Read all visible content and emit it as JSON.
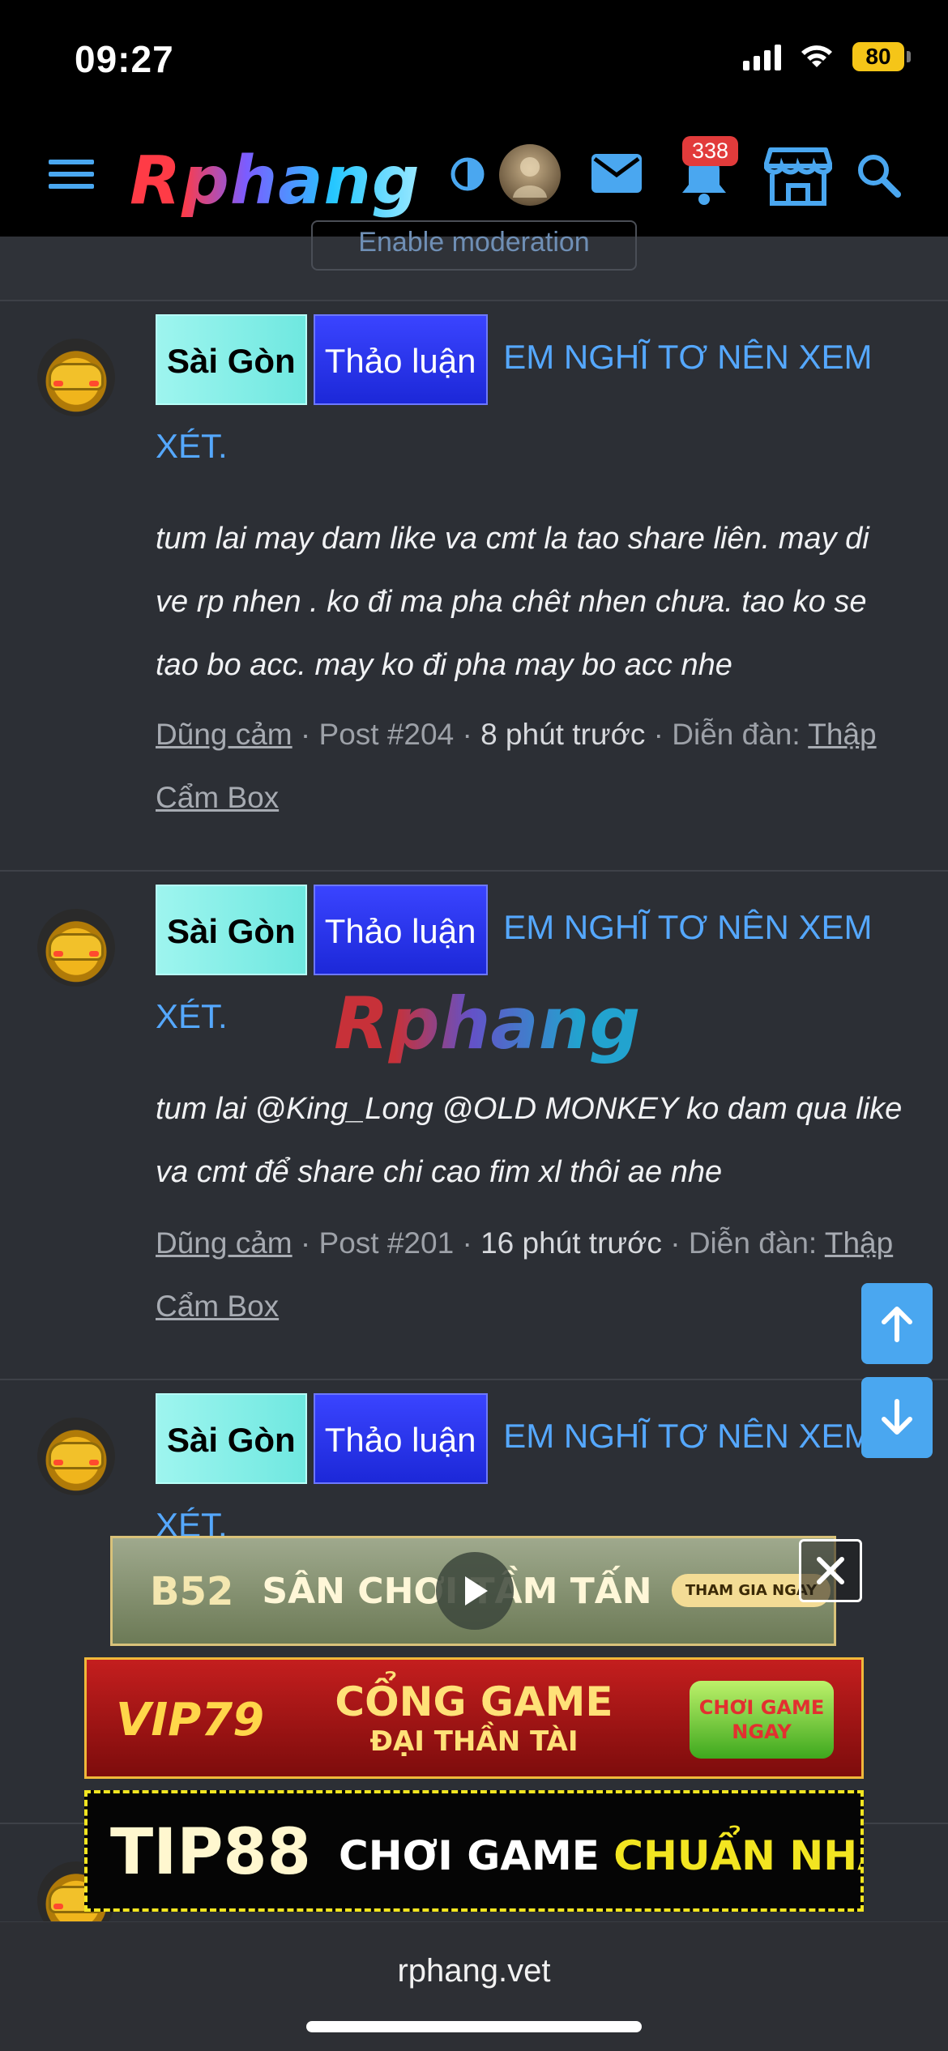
{
  "status_bar": {
    "time": "09:27",
    "battery": "80"
  },
  "nav": {
    "logo": "Rphang",
    "notification_count": "338"
  },
  "prev_block": {
    "button_label": "Enable moderation"
  },
  "posts": [
    {
      "tag1": "Sài Gòn",
      "tag2": "Thảo luận",
      "title_a": "EM NGHĨ TƠ NÊN XEM",
      "title_b": "XÉT.",
      "body_1": "tum lai may dam like va cmt la tao share liên. may di",
      "body_2": "ve rp nhen . ko đi ma pha chêt nhen chưa. tao ko se",
      "body_3": "tao bo acc. may ko đi pha may bo acc nhe",
      "author": "Dũng cảm",
      "post_no": "Post #204",
      "time": "8 phút trước",
      "forum_label": "Diễn đàn:",
      "forum": "Thập Cẩm Box"
    },
    {
      "tag1": "Sài Gòn",
      "tag2": "Thảo luận",
      "title_a": "EM NGHĨ TƠ NÊN XEM",
      "title_b": "XÉT.",
      "body_1": "tum lai @King_Long @OLD MONKEY ko dam qua like",
      "body_2": "va cmt để share chi cao fim xl thôi ae nhe",
      "author": "Dũng cảm",
      "post_no": "Post #201",
      "time": "16 phút trước",
      "forum_label": "Diễn đàn:",
      "forum": "Thập Cẩm Box"
    },
    {
      "tag1": "Sài Gòn",
      "tag2": "Thảo luận",
      "title_a": "EM NGHĨ TƠ NÊN XEM",
      "title_b": "XÉT."
    }
  ],
  "watermark": "Rphang",
  "ads": [
    {
      "logo": "B52",
      "title": "SÂN CHƠI TẦM TẤN",
      "cta": "THAM GIA NGAY"
    },
    {
      "logo": "VIP79",
      "title_1": "CỔNG GAME",
      "title_2": "ĐẠI THẦN TÀI",
      "cta": "CHƠI GAME NGAY"
    },
    {
      "logo": "TIP88",
      "title_a": "CHƠI GAME",
      "title_b": "CHUẨN NHÀ CÁI"
    }
  ],
  "browser": {
    "url": "rphang.vet"
  },
  "colors": {
    "link": "#55a8ff",
    "tag_cyan": "#6fe8e0",
    "tag_blue": "#1c28d8",
    "scroll_button": "#4aa7f0",
    "badge": "#e23b3b"
  }
}
